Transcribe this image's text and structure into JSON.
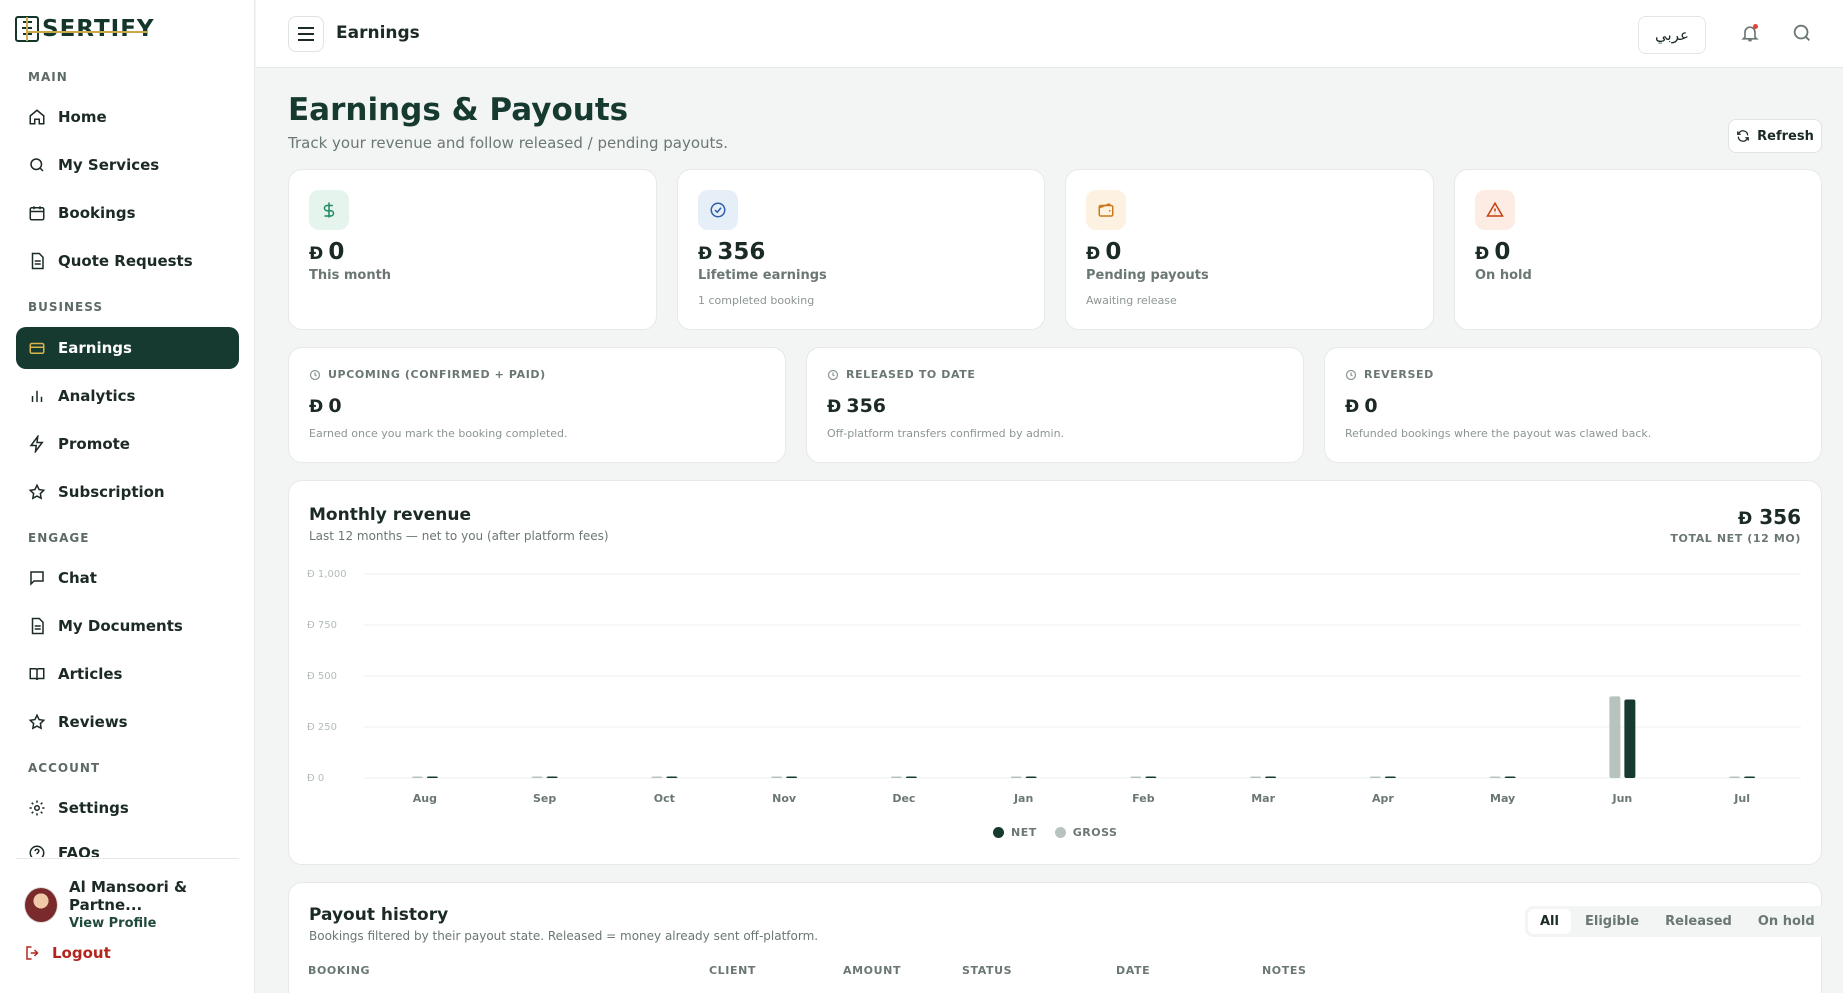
{
  "brand": {
    "name": "SERTIFY"
  },
  "sidebar": {
    "sections": {
      "main": "MAIN",
      "business": "BUSINESS",
      "engage": "ENGAGE",
      "account": "ACCOUNT"
    },
    "items": {
      "home": "Home",
      "services": "My Services",
      "bookings": "Bookings",
      "quotes": "Quote Requests",
      "earnings": "Earnings",
      "analytics": "Analytics",
      "promote": "Promote",
      "subscription": "Subscription",
      "chat": "Chat",
      "documents": "My Documents",
      "articles": "Articles",
      "reviews": "Reviews",
      "settings": "Settings",
      "faqs": "FAQs"
    },
    "profile": {
      "name": "Al Mansoori & Partne...",
      "link": "View Profile"
    },
    "logout": "Logout"
  },
  "topbar": {
    "title": "Earnings",
    "language": "عربي"
  },
  "page": {
    "title": "Earnings & Payouts",
    "subtitle": "Track your revenue and follow released / pending payouts.",
    "refresh": "Refresh"
  },
  "currency_symbol": "Đ",
  "stats": [
    {
      "value": "0",
      "label": "This month",
      "note": ""
    },
    {
      "value": "356",
      "label": "Lifetime earnings",
      "note": "1 completed booking"
    },
    {
      "value": "0",
      "label": "Pending payouts",
      "note": "Awaiting release"
    },
    {
      "value": "0",
      "label": "On hold",
      "note": ""
    }
  ],
  "summary": [
    {
      "label": "UPCOMING (CONFIRMED + PAID)",
      "value": "0",
      "note": "Earned once you mark the booking completed."
    },
    {
      "label": "RELEASED TO DATE",
      "value": "356",
      "note": "Off-platform transfers confirmed by admin."
    },
    {
      "label": "REVERSED",
      "value": "0",
      "note": "Refunded bookings where the payout was clawed back."
    }
  ],
  "revenue": {
    "title": "Monthly revenue",
    "subtitle": "Last 12 months — net to you (after platform fees)",
    "total_value": "356",
    "total_label": "TOTAL NET (12 MO)",
    "legend": {
      "net": "NET",
      "gross": "GROSS"
    },
    "colors": {
      "net": "#163a2f",
      "gross": "#b7c4be"
    }
  },
  "chart_data": {
    "type": "bar",
    "categories": [
      "Aug",
      "Sep",
      "Oct",
      "Nov",
      "Dec",
      "Jan",
      "Feb",
      "Mar",
      "Apr",
      "May",
      "Jun",
      "Jul"
    ],
    "series": [
      {
        "name": "GROSS",
        "values": [
          0,
          0,
          0,
          0,
          0,
          0,
          0,
          0,
          0,
          0,
          400,
          0
        ]
      },
      {
        "name": "NET",
        "values": [
          0,
          0,
          0,
          0,
          0,
          0,
          0,
          0,
          0,
          0,
          385,
          0
        ]
      }
    ],
    "yticks": [
      "Đ 0",
      "Đ 250",
      "Đ 500",
      "Đ 750",
      "Đ 1,000"
    ],
    "ylim": [
      0,
      1000
    ],
    "legend_position": "bottom-center"
  },
  "payouts": {
    "title": "Payout history",
    "subtitle": "Bookings filtered by their payout state. Released = money already sent off-platform.",
    "filters": [
      "All",
      "Eligible",
      "Released",
      "On hold"
    ],
    "columns": [
      "BOOKING",
      "CLIENT",
      "AMOUNT",
      "STATUS",
      "DATE",
      "NOTES"
    ]
  }
}
